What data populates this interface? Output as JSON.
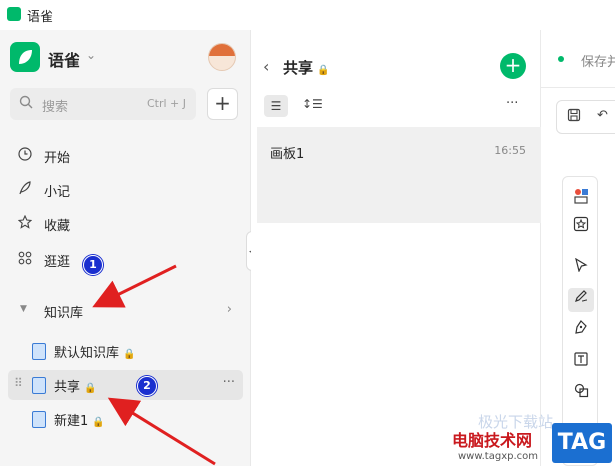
{
  "titlebar": {
    "title": "语雀"
  },
  "sidebar": {
    "app_name": "语雀",
    "search": {
      "placeholder": "搜索",
      "shortcut": "Ctrl + J"
    },
    "add_label": "+",
    "nav": [
      {
        "label": "开始",
        "icon": "clock-icon"
      },
      {
        "label": "小记",
        "icon": "feather-icon"
      },
      {
        "label": "收藏",
        "icon": "star-icon"
      },
      {
        "label": "逛逛",
        "icon": "grid-icon"
      }
    ],
    "kb_section": {
      "label": "知识库"
    },
    "kb_items": [
      {
        "label": "默认知识库",
        "locked": true
      },
      {
        "label": "共享",
        "locked": true,
        "active": true
      },
      {
        "label": "新建1",
        "locked": true
      }
    ]
  },
  "middle": {
    "title": "共享",
    "docs": [
      {
        "name": "画板1",
        "time": "16:55"
      }
    ]
  },
  "editor": {
    "save_status": "保存并"
  },
  "annotations": {
    "badge_1": "1",
    "badge_2": "2",
    "arrow_color": "#e02020"
  },
  "watermark": {
    "brand": "电脑技术网",
    "url": "www.tagxp.com",
    "tag": "TAG",
    "faint": "极光下载站"
  }
}
